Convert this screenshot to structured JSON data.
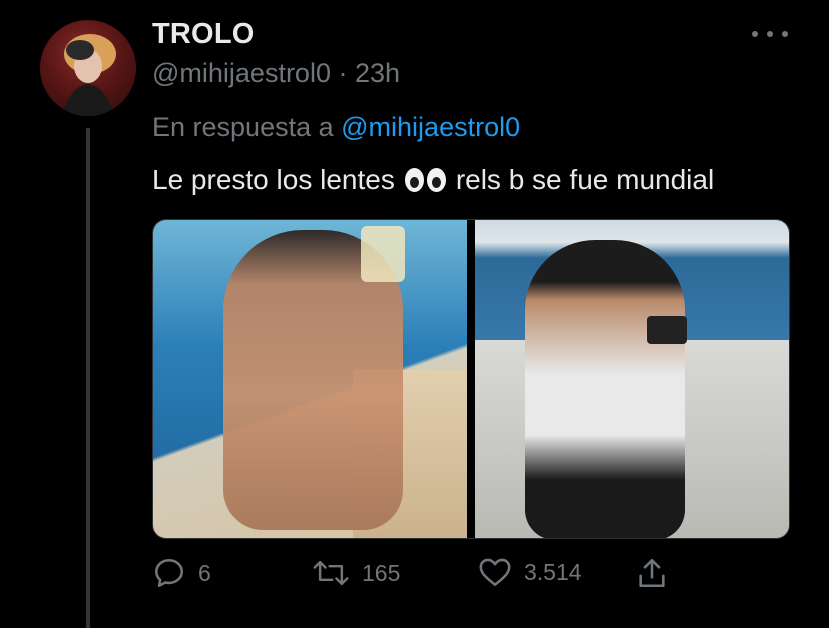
{
  "tweet": {
    "display_name": "TROLO",
    "handle": "@mihijaestrol0",
    "separator": "·",
    "time": "23h",
    "reply_prefix": "En respuesta a",
    "reply_to": "@mihijaestrol0",
    "text_before_emoji": "Le presto los lentes",
    "emoji": "eyes",
    "text_after_emoji": "rels b se fue mundial",
    "media": [
      {
        "icon": "photo-woman-in-pool"
      },
      {
        "icon": "photo-man-on-boat-with-camera"
      }
    ]
  },
  "actions": {
    "reply_count": "6",
    "retweet_count": "165",
    "like_count": "3.514"
  },
  "colors": {
    "background": "#000000",
    "text": "#e7e9ea",
    "secondary": "#71767b",
    "accent": "#1d9bf0"
  }
}
